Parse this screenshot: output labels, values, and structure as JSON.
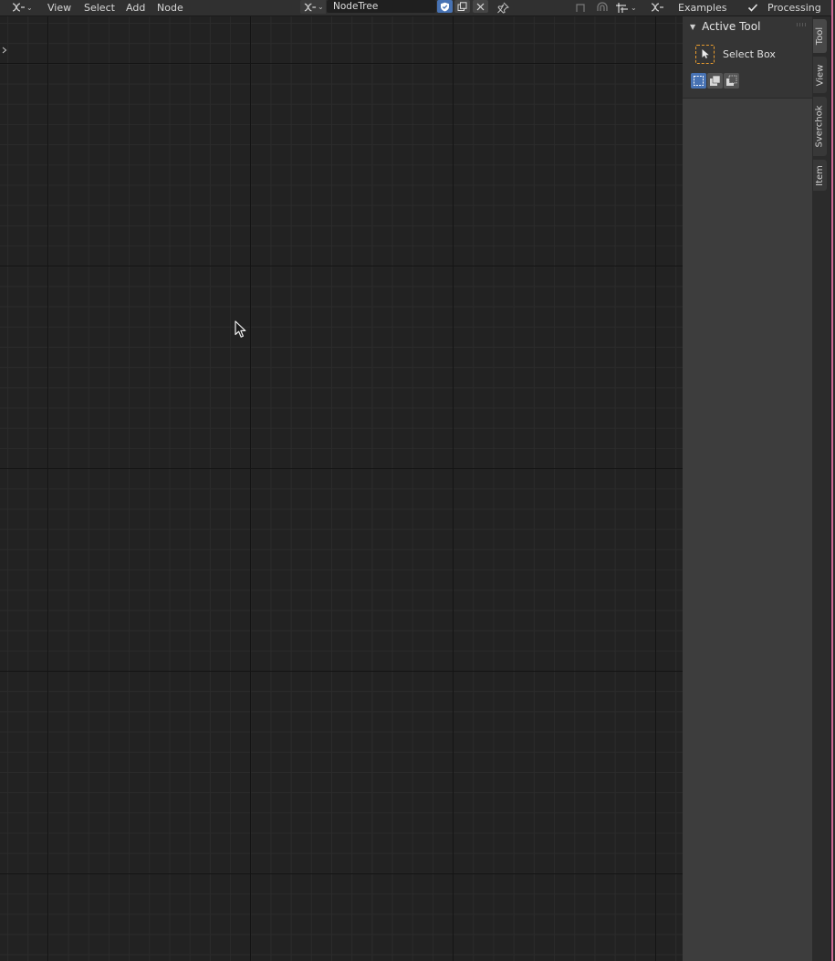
{
  "header": {
    "menus": [
      "View",
      "Select",
      "Add",
      "Node"
    ],
    "node_tree_name": "NodeTree",
    "examples_label": "Examples",
    "processing_label": "Processing"
  },
  "sidebar": {
    "panel_title": "Active Tool",
    "tool_label": "Select Box",
    "tabs": [
      "Tool",
      "View",
      "Sverchok",
      "Item"
    ]
  },
  "colors": {
    "accent": "#4772b3",
    "tool_outline": "#e89b2e",
    "edge_highlight": "#d36a98"
  },
  "icons": {
    "editor_type": "sverchok-icon",
    "cursor": "mouse-pointer-icon"
  }
}
